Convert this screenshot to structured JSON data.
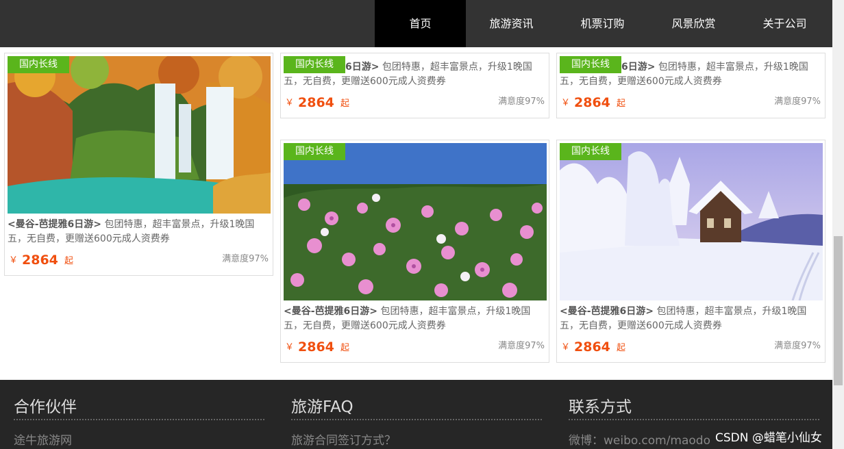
{
  "nav": {
    "items": [
      {
        "label": "首页",
        "active": true
      },
      {
        "label": "旅游资讯",
        "active": false
      },
      {
        "label": "机票订购",
        "active": false
      },
      {
        "label": "风景欣赏",
        "active": false
      },
      {
        "label": "关于公司",
        "active": false
      }
    ]
  },
  "cards": [
    {
      "tag": "国内长线",
      "title": "<曼谷-芭提雅6日游>",
      "title_partial": "6日游>",
      "desc": " 包团特惠，超丰富景点，升级1晚国五，无自费，更赠送600元成人资费券",
      "currency": "￥",
      "price": "2864",
      "suffix": "起",
      "satisfaction": "满意度97%",
      "image": "waterfall"
    },
    {
      "tag": "国内长线",
      "title": "<曼谷-芭提雅6日游>",
      "title_partial": "6日游>",
      "desc": " 包团特惠，超丰富景点，升级1晚国五，无自费，更赠送600元成人资费券",
      "currency": "￥",
      "price": "2864",
      "suffix": "起",
      "satisfaction": "满意度97%",
      "image": "none"
    },
    {
      "tag": "国内长线",
      "title": "<曼谷-芭提雅6日游>",
      "title_partial": "6日游>",
      "desc": " 包团特惠，超丰富景点，升级1晚国五，无自费，更赠送600元成人资费券",
      "currency": "￥",
      "price": "2864",
      "suffix": "起",
      "satisfaction": "满意度97%",
      "image": "none"
    },
    {
      "tag": "国内长线",
      "title": "<曼谷-芭提雅6日游>",
      "title_partial": "6日游>",
      "desc": " 包团特惠，超丰富景点，升级1晚国五，无自费，更赠送600元成人资费券",
      "currency": "￥",
      "price": "2864",
      "suffix": "起",
      "satisfaction": "满意度97%",
      "image": "flowers"
    },
    {
      "tag": "国内长线",
      "title": "<曼谷-芭提雅6日游>",
      "title_partial": "6日游>",
      "desc": " 包团特惠，超丰富景点，升级1晚国五，无自费，更赠送600元成人资费券",
      "currency": "￥",
      "price": "2864",
      "suffix": "起",
      "satisfaction": "满意度97%",
      "image": "snow-cabin"
    }
  ],
  "footer": {
    "columns": [
      {
        "title": "合作伙伴",
        "link": "途牛旅游网"
      },
      {
        "title": "旅游FAQ",
        "link": "旅游合同签订方式？"
      },
      {
        "title": "联系方式",
        "link": "微博：weibo.com/maodo"
      }
    ]
  },
  "watermark": "CSDN @蜡笔小仙女",
  "colors": {
    "accent_green": "#5ab51c",
    "price_orange": "#f04f0f",
    "nav_bg": "#333333",
    "footer_bg": "#262626"
  }
}
